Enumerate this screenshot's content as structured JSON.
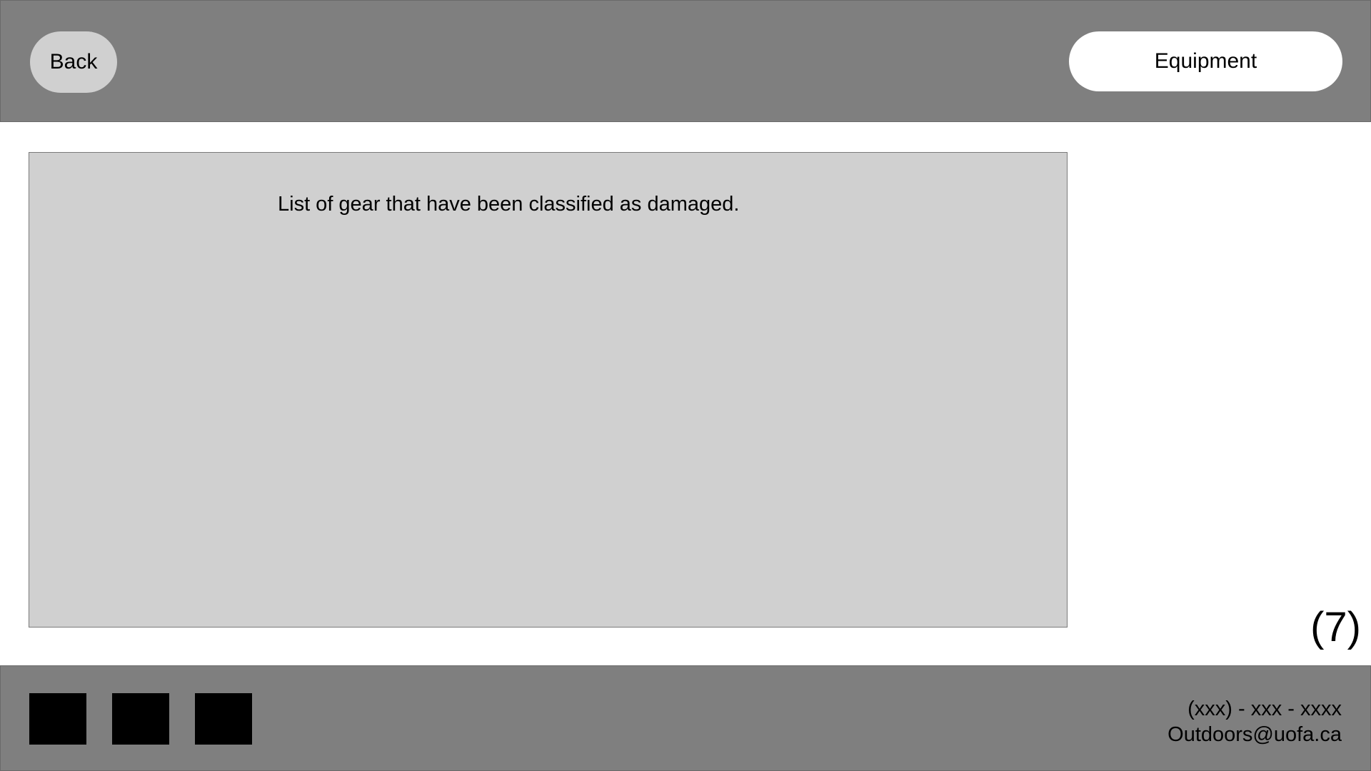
{
  "header": {
    "back_label": "Back",
    "equipment_label": "Equipment"
  },
  "main": {
    "panel_text": "List of gear that have been classified as damaged."
  },
  "page_indicator": "(7)",
  "footer": {
    "social_icons": [
      "social-icon-1",
      "social-icon-2",
      "social-icon-3"
    ],
    "phone": "(xxx) - xxx - xxxx",
    "email": "Outdoors@uofa.ca"
  },
  "colors": {
    "bar": "#7f7f7f",
    "panel": "#d0d0d0",
    "back_button": "#d0d0d0",
    "equipment_button": "#ffffff",
    "icon": "#000000"
  }
}
